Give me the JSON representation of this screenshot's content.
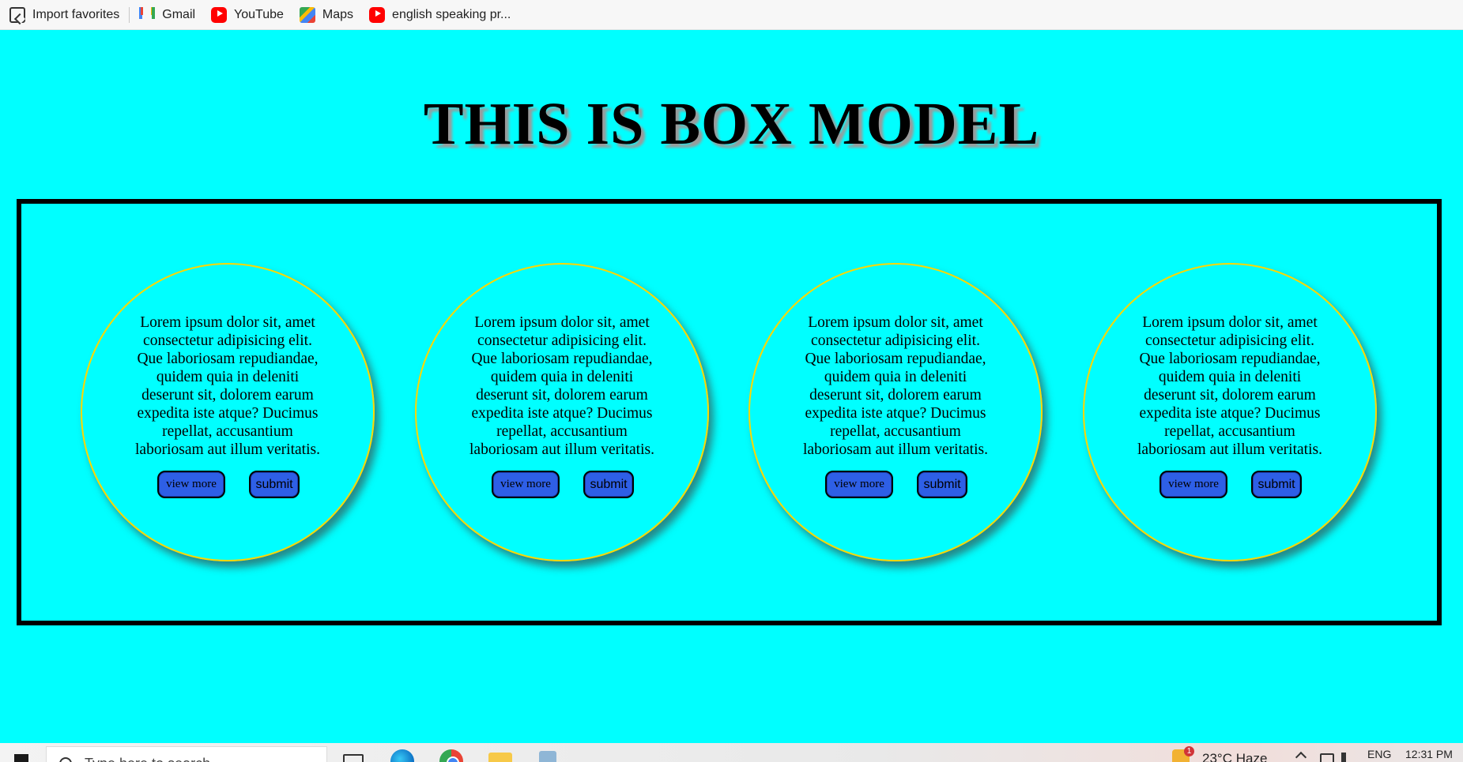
{
  "favorites": [
    {
      "label": "Import favorites",
      "icon": "import-icon"
    },
    {
      "label": "Gmail",
      "icon": "gmail-icon"
    },
    {
      "label": "YouTube",
      "icon": "youtube-icon"
    },
    {
      "label": "Maps",
      "icon": "maps-icon"
    },
    {
      "label": "english speaking pr...",
      "icon": "youtube-icon"
    }
  ],
  "page": {
    "title": "THIS IS BOX MODEL",
    "background_color": "#00ffff",
    "circle_border_color": "#ffd700",
    "button_color": "#2e5fe6"
  },
  "cards": [
    {
      "text": "Lorem ipsum dolor sit, amet consectetur adipisicing elit. Que laboriosam repudiandae, quidem quia in deleniti deserunt sit, dolorem earum expedita iste atque? Ducimus repellat, accusantium laboriosam aut illum veritatis.",
      "view_more_label": "view more",
      "submit_label": "submit"
    },
    {
      "text": "Lorem ipsum dolor sit, amet consectetur adipisicing elit. Que laboriosam repudiandae, quidem quia in deleniti deserunt sit, dolorem earum expedita iste atque? Ducimus repellat, accusantium laboriosam aut illum veritatis.",
      "view_more_label": "view more",
      "submit_label": "submit"
    },
    {
      "text": "Lorem ipsum dolor sit, amet consectetur adipisicing elit. Que laboriosam repudiandae, quidem quia in deleniti deserunt sit, dolorem earum expedita iste atque? Ducimus repellat, accusantium laboriosam aut illum veritatis.",
      "view_more_label": "view more",
      "submit_label": "submit"
    },
    {
      "text": "Lorem ipsum dolor sit, amet consectetur adipisicing elit. Que laboriosam repudiandae, quidem quia in deleniti deserunt sit, dolorem earum expedita iste atque? Ducimus repellat, accusantium laboriosam aut illum veritatis.",
      "view_more_label": "view more",
      "submit_label": "submit"
    }
  ],
  "taskbar": {
    "search_placeholder": "Type here to search",
    "weather": "23°C  Haze",
    "weather_badge": "1",
    "language": "ENG",
    "time": "12:31 PM"
  }
}
